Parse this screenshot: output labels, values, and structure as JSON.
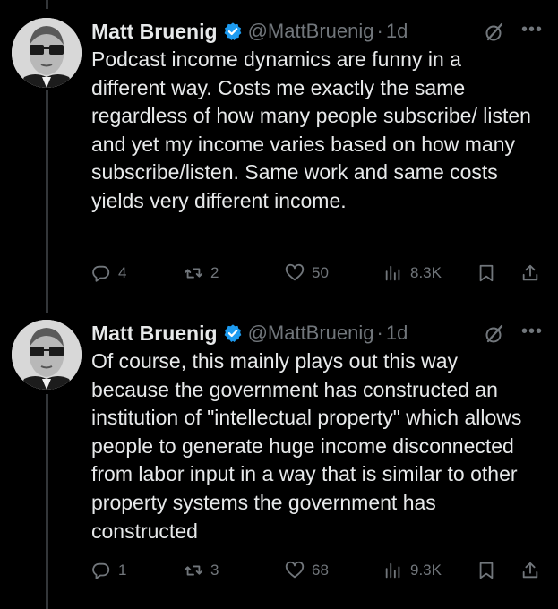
{
  "colors": {
    "background": "#000000",
    "text": "#e7e9ea",
    "secondary": "#71767b",
    "verified": "#1d9bf0",
    "thread_line": "#333639"
  },
  "tweets": [
    {
      "author_name": "Matt Bruenig",
      "handle": "@MattBruenig",
      "separator": "·",
      "time": "1d",
      "text": "Podcast income dynamics are funny in a different way. Costs me exactly the same regardless of how many people subscribe/ listen and yet my income varies based on how many subscribe/listen. Same work and same costs yields very different income.",
      "replies": "4",
      "reposts": "2",
      "likes": "50",
      "views": "8.3K",
      "icons": [
        "verified-badge-icon",
        "grok-icon",
        "more-icon",
        "reply-icon",
        "repost-icon",
        "like-icon",
        "views-icon",
        "bookmark-icon",
        "share-icon"
      ]
    },
    {
      "author_name": "Matt Bruenig",
      "handle": "@MattBruenig",
      "separator": "·",
      "time": "1d",
      "text": "Of course, this mainly plays out this way because the government has constructed an institution of \"intellectual property\" which allows people to generate huge income disconnected from labor input in a way that is similar to other property systems the government has constructed",
      "replies": "1",
      "reposts": "3",
      "likes": "68",
      "views": "9.3K",
      "icons": [
        "verified-badge-icon",
        "grok-icon",
        "more-icon",
        "reply-icon",
        "repost-icon",
        "like-icon",
        "views-icon",
        "bookmark-icon",
        "share-icon"
      ]
    }
  ]
}
